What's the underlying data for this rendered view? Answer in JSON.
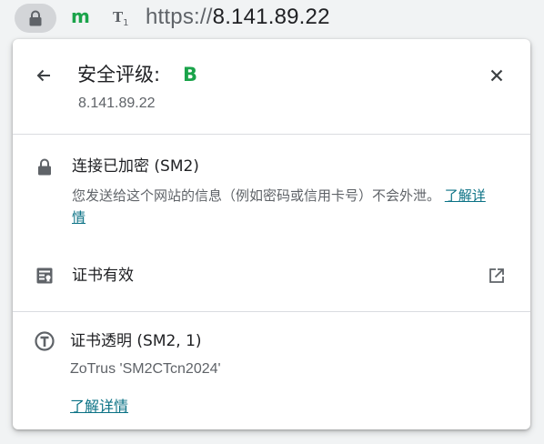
{
  "browser": {
    "extension_label": "m",
    "translate_icon_label": "T",
    "translate_icon_sub": "1",
    "url_scheme": "https://",
    "url_host": "8.141.89.22"
  },
  "popup": {
    "title": "安全评级:",
    "grade": "B",
    "host": "8.141.89.22",
    "connection": {
      "title": "连接已加密 (SM2)",
      "description": "您发送给这个网站的信息（例如密码或信用卡号）不会外泄。",
      "link": "了解详情"
    },
    "certificate": {
      "label": "证书有效"
    },
    "transparency": {
      "title": "证书透明 (SM2, 1)",
      "detail": "ZoTrus 'SM2CTcn2024'",
      "link": "了解详情"
    }
  },
  "colors": {
    "grade": "#1aa34a",
    "link": "#0b7285",
    "icon": "#5f6368"
  }
}
